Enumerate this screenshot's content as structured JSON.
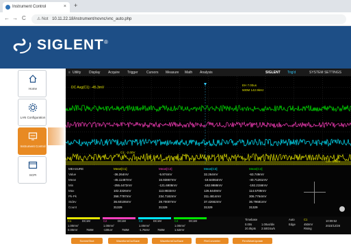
{
  "browser": {
    "tab_title": "Instrument Control",
    "tab_close": "×",
    "new_tab": "+",
    "nav_back": "←",
    "nav_forward": "→",
    "nav_reload": "C",
    "url_warning": "⚠ Not",
    "url": "10.11.22.18/instrument/novnc/vnc_auto.php"
  },
  "brand": {
    "logo_text": "SIGLENT",
    "logo_reg": "®"
  },
  "sidebar": {
    "items": [
      {
        "label": "Home",
        "icon": "house-icon"
      },
      {
        "label": "LAN Configuration",
        "icon": "gear-icon"
      },
      {
        "label": "Instrument Control",
        "icon": "monitor-icon",
        "active": true
      },
      {
        "label": "SCPI",
        "icon": "terminal-icon"
      }
    ]
  },
  "scope": {
    "menu": [
      "Utility",
      "Display",
      "Acquire",
      "Trigger",
      "Cursors",
      "Measure",
      "Math",
      "Analysis"
    ],
    "menu_right": "SIGLENT",
    "status_label": "Trig'd",
    "system_settings": "SYSTEM SETTINGS",
    "dc_avg": "DC Avg(C1): -45.3mV",
    "timebase_info": "EH 7.00us",
    "rate_info": "500M 142.9kHz",
    "trigger_level": "C1: -2.00V",
    "right_label": "C4= 0.00V",
    "colors": {
      "c1": "#e6e600",
      "c2": "#ff3fbf",
      "c3": "#00e6ff",
      "c4": "#00e600",
      "accent": "#e88a23"
    },
    "measure_headers": [
      "MEASURE",
      "Mean[C1]",
      "Mean[C2]",
      "Mean[C3]",
      "Mean[C4]"
    ],
    "measure_rows": [
      [
        "Value",
        "-36.264mV",
        "-5.974mV",
        "32.264mV",
        "-63.749mV"
      ],
      [
        "Mean",
        "-45.11487mV",
        "16.93867mV",
        "-18.64064mV",
        "-40.71261mV"
      ],
      [
        "Min",
        "-255.4472mV",
        "-121.6908mV",
        "-182.9988mV",
        "-192.2158mV"
      ],
      [
        "Max",
        "102.3326mV",
        "113.8833mV",
        "126.6449mV",
        "114.5709mV"
      ],
      [
        "Pk-Pk",
        "358.7797mV",
        "234.7182mV",
        "311.4814mV",
        "306.7764mV"
      ],
      [
        "Stdev",
        "36.60106mV",
        "28.70007mV",
        "37.42662mV",
        "36.79681mV"
      ],
      [
        "Count",
        "31329",
        "31329",
        "31329",
        "31329"
      ]
    ],
    "channels": [
      {
        "name": "C1",
        "coupling": "DC1M",
        "scale": "1.00mV/",
        "offset": "0.00mV",
        "extra": "750M"
      },
      {
        "name": "C2",
        "coupling": "DC1M",
        "scale": "1.00mV/",
        "offset": "-100uV",
        "extra": "750M"
      },
      {
        "name": "C3",
        "coupling": "DC1M",
        "scale": "1.00mV/",
        "offset": "-1.76mV",
        "extra": "750M"
      },
      {
        "name": "C4",
        "coupling": "DC1M",
        "scale": "1.00mV/",
        "offset": "1.52mV",
        "extra": ""
      }
    ],
    "timebase": {
      "label": "Timebase",
      "delay": "0.00s",
      "scale": "1.00us/div",
      "rate": "20.0kpts",
      "srate": "2.50GSa/s"
    },
    "trigger": {
      "mode": "Auto",
      "type": "Edge",
      "source": "C1",
      "level": "450mV",
      "slope": "Rising"
    },
    "clock": {
      "time": "10:09:52",
      "date": "2023/12/28"
    }
  },
  "bottom_buttons": [
    "ScreenShot",
    "WaveformCsvSave",
    "WaveformCsvSave",
    "FileConverter",
    "FirmWareUpdate"
  ]
}
